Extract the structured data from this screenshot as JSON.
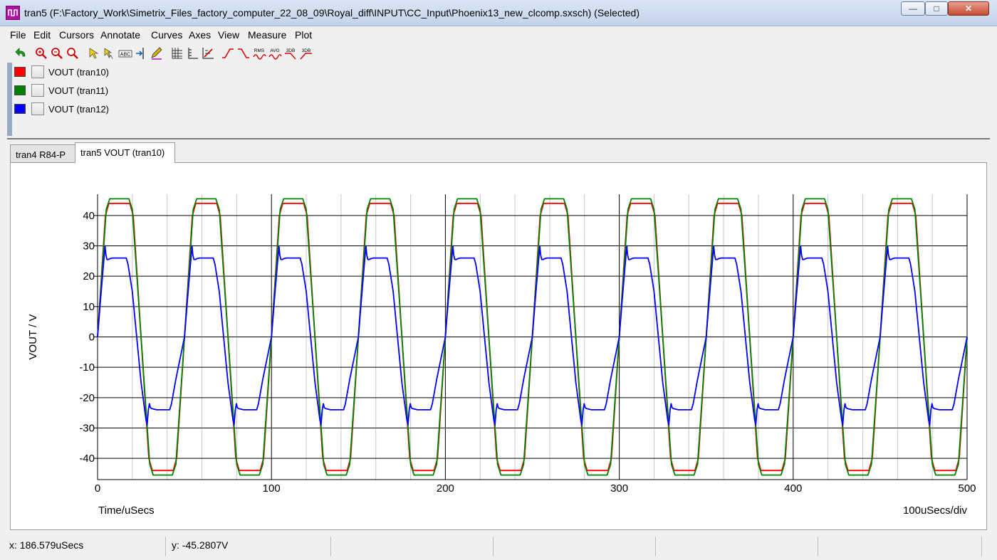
{
  "window": {
    "title": "tran5 (F:\\Factory_Work\\Simetrix_Files_factory_computer_22_08_09\\Royal_diff\\INPUT\\CC_Input\\Phoenix13_new_clcomp.sxsch) (Selected)",
    "buttons": {
      "minimize": "—",
      "maximize": "□",
      "close": "✕"
    }
  },
  "menu": [
    "File",
    "Edit",
    "Cursors",
    "Annotate",
    "Curves",
    "Axes",
    "View",
    "Measure",
    "Plot"
  ],
  "toolbar": [
    {
      "name": "undo-zoom-icon"
    },
    {
      "name": "zoom-in-icon"
    },
    {
      "name": "zoom-out-icon"
    },
    {
      "name": "zoom-full-icon"
    },
    {
      "name": "cursor-icon"
    },
    {
      "name": "cursor-pair-icon"
    },
    {
      "name": "label-abc-icon",
      "text": "ABC"
    },
    {
      "name": "marker-icon"
    },
    {
      "name": "pen-icon"
    },
    {
      "name": "grid-icon"
    },
    {
      "name": "axis-icon"
    },
    {
      "name": "scale-icon"
    },
    {
      "name": "rise-time-icon"
    },
    {
      "name": "fall-time-icon"
    },
    {
      "name": "rms-icon",
      "text": "RMS"
    },
    {
      "name": "average-icon",
      "text": "AVG"
    },
    {
      "name": "3db-low-icon",
      "text": "3DB"
    },
    {
      "name": "3db-high-icon",
      "text": "3DB"
    }
  ],
  "legend": [
    {
      "label": "VOUT (tran10)",
      "color": "#ff0000"
    },
    {
      "label": "VOUT (tran11)",
      "color": "#008000"
    },
    {
      "label": "VOUT (tran12)",
      "color": "#0000ff"
    }
  ],
  "tabs": [
    {
      "label": "tran4 R84-P",
      "active": false
    },
    {
      "label": "tran5 VOUT (tran10)",
      "active": true
    }
  ],
  "status": {
    "x": "x: 186.579uSecs",
    "y": "y: -45.2807V"
  },
  "chart_data": {
    "type": "line",
    "xlabel": "Time/uSecs",
    "ylabel": "VOUT / V",
    "x_scale_note": "100uSecs/div",
    "xlim": [
      0,
      500
    ],
    "ylim": [
      -47,
      47
    ],
    "x_ticks": [
      0,
      100,
      200,
      300,
      400,
      500
    ],
    "x_minor_ticks": [
      20,
      40,
      60,
      80,
      120,
      140,
      160,
      180,
      220,
      240,
      260,
      280,
      320,
      340,
      360,
      380,
      420,
      440,
      460,
      480
    ],
    "y_ticks": [
      -40,
      -30,
      -20,
      -10,
      0,
      10,
      20,
      30,
      40
    ],
    "grid": true,
    "period": 50,
    "series": [
      {
        "name": "VOUT (tran10)",
        "color": "#ff0000",
        "x": [
          0,
          4.5,
          6.5,
          7.5,
          17.5,
          18.5,
          20.5,
          29.5,
          31.5,
          32.5,
          42.5,
          43.5,
          45.5,
          50
        ],
        "y": [
          0,
          40,
          44,
          44,
          44,
          44,
          40,
          -40,
          -44,
          -44,
          -44,
          -44,
          -40,
          0
        ]
      },
      {
        "name": "VOUT (tran11)",
        "color": "#008000",
        "x": [
          0,
          5,
          7,
          9,
          16,
          18,
          20,
          30,
          32,
          34,
          41,
          43,
          45,
          50
        ],
        "y": [
          0,
          42,
          45.5,
          45.5,
          45.5,
          45.5,
          42,
          -42,
          -45.5,
          -45.5,
          -45.5,
          -45.5,
          -42,
          0
        ]
      },
      {
        "name": "VOUT (tran12)",
        "color": "#0000ff",
        "x": [
          0,
          1.8,
          3.5,
          4.3,
          4.8,
          5.4,
          6.2,
          7.2,
          8.5,
          11,
          16.5,
          17.5,
          20,
          25,
          27.9,
          28.5,
          29.2,
          29.8,
          30.4,
          31.2,
          32.5,
          34,
          36,
          41.5,
          42.5,
          45,
          50
        ],
        "y": [
          0,
          13,
          24.5,
          30,
          27,
          25.5,
          25.5,
          25.8,
          26,
          26,
          26,
          24,
          15,
          -15,
          -27.5,
          -29,
          -24,
          -22,
          -23.3,
          -23.6,
          -23.8,
          -24,
          -24,
          -24,
          -22,
          -14,
          0
        ]
      }
    ],
    "cycles": 10
  }
}
